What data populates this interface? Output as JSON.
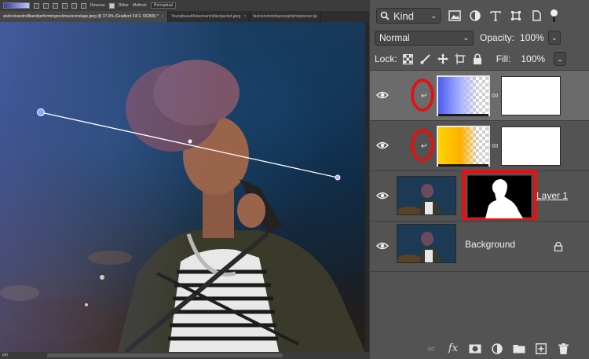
{
  "options_bar": {
    "reverse_label": "Reverse",
    "dither_label": "Dither",
    "method_label": "Method:",
    "method_value": "Perceptual"
  },
  "tabs": [
    {
      "label": "androckandrollbandperformingrockmusiconstage.jpeg @ 37.9% (Gradient Fill 2, RGB/8) *",
      "close": "×"
    },
    {
      "label": "Youngbeautifulwomaninblackjacket.jpeg",
      "close": "×"
    },
    {
      "label": "fashionshotofayounghiphopdancer.jp",
      "close": ""
    }
  ],
  "status_text": "px)",
  "layers_panel": {
    "filter": {
      "kind_label": "Kind"
    },
    "blend_mode": "Normal",
    "opacity_label": "Opacity:",
    "opacity_value": "100%",
    "lock_label": "Lock:",
    "fill_label": "Fill:",
    "fill_value": "100%",
    "layers": [
      {
        "name": "",
        "type": "gradient-fill",
        "colors": [
          "#4a5cf0",
          "#a9b4ff"
        ],
        "selected": true,
        "clipped": true
      },
      {
        "name": "",
        "type": "gradient-fill",
        "colors": [
          "#ffd200",
          "#ffb000"
        ],
        "selected": false,
        "clipped": true
      },
      {
        "name": "Layer 1",
        "type": "pixel-with-mask",
        "selected": false
      },
      {
        "name": "Background",
        "type": "background",
        "selected": false,
        "locked": true
      }
    ]
  },
  "colors": {
    "highlight_red": "#e01212",
    "panel_bg": "#535353"
  }
}
